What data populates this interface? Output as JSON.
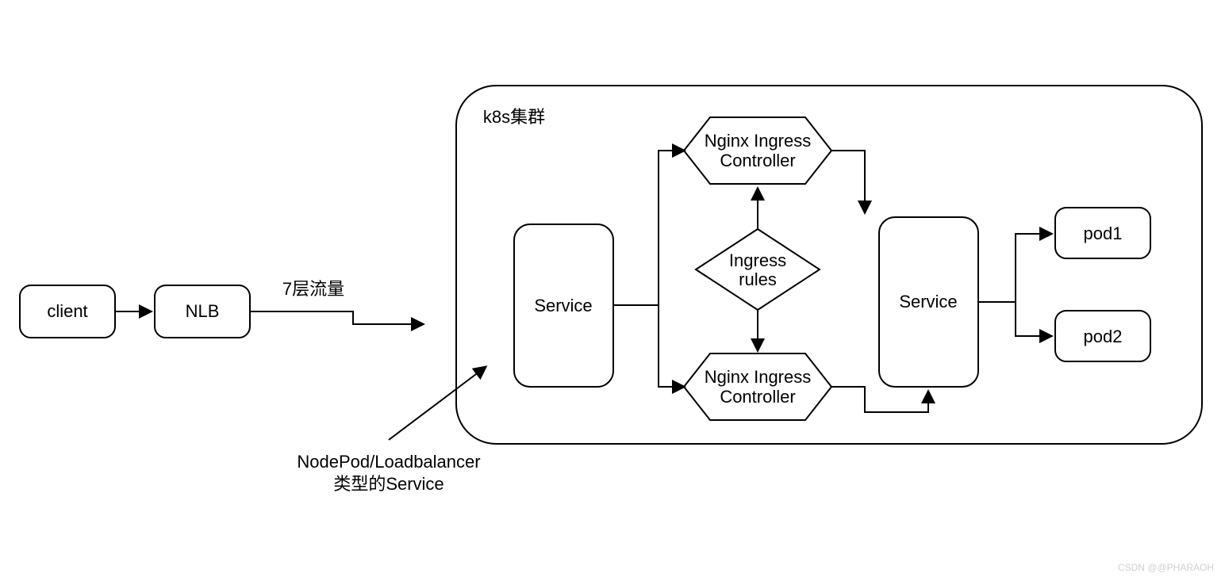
{
  "nodes": {
    "client": "client",
    "nlb": "NLB",
    "traffic_label": "7层流量",
    "cluster_title": "k8s集群",
    "service_left": "Service",
    "nginx_top_l1": "Nginx Ingress",
    "nginx_top_l2": "Controller",
    "nginx_bottom_l1": "Nginx Ingress",
    "nginx_bottom_l2": "Controller",
    "rules_l1": "Ingress",
    "rules_l2": "rules",
    "service_right": "Service",
    "pod1": "pod1",
    "pod2": "pod2",
    "note_l1": "NodePod/Loadbalancer",
    "note_l2": "类型的Service",
    "watermark": "CSDN @@PHARAOH"
  }
}
